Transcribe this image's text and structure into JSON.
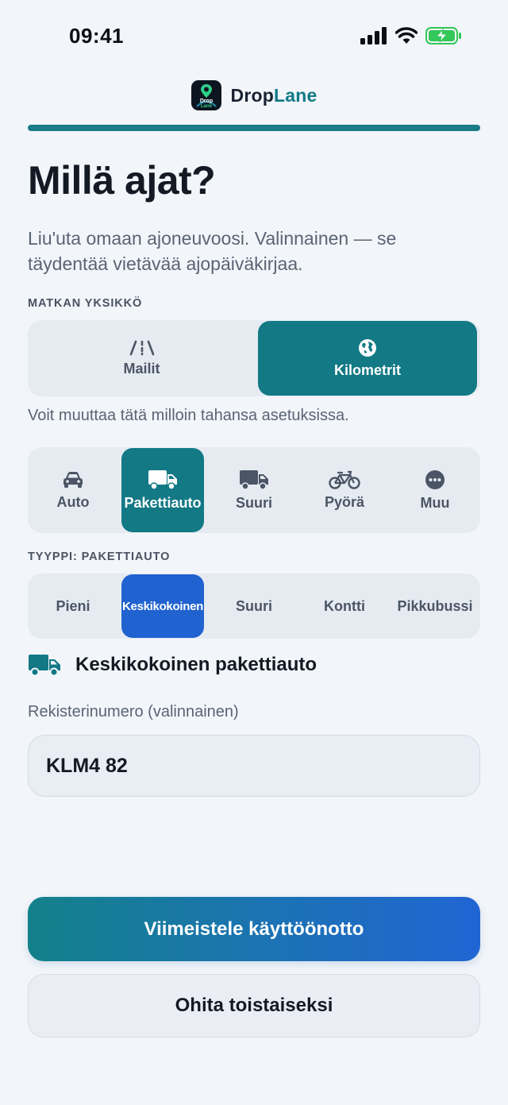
{
  "status_bar": {
    "time": "09:41",
    "icons": [
      "signal-icon",
      "wifi-icon",
      "battery-charging-icon"
    ]
  },
  "brand": {
    "logo_text_1": "Drop",
    "logo_text_2": "Lane",
    "name_part1": "Drop",
    "name_part2": "Lane",
    "accent_color": "#0f7a86"
  },
  "progress": {
    "value": 1.0,
    "color": "#1a7c87"
  },
  "title": "Millä ajat?",
  "subtitle": "Liu'uta omaan ajoneuvoosi. Valinnainen — se täydentää vietävää ajopäiväkirjaa.",
  "unit_section": {
    "label": "MATKAN YKSIKKÖ",
    "options": [
      {
        "label": "Mailit",
        "icon": "road-icon",
        "selected": false
      },
      {
        "label": "Kilometrit",
        "icon": "globe-icon",
        "selected": true
      }
    ],
    "hint": "Voit muuttaa tätä milloin tahansa asetuksissa."
  },
  "vehicle_categories": [
    {
      "label": "Auto",
      "icon": "car-icon",
      "selected": false
    },
    {
      "label": "Pakettiauto",
      "icon": "van-icon",
      "selected": true
    },
    {
      "label": "Suuri",
      "icon": "truck-icon",
      "selected": false
    },
    {
      "label": "Pyörä",
      "icon": "bicycle-icon",
      "selected": false
    },
    {
      "label": "Muu",
      "icon": "more-icon",
      "selected": false
    }
  ],
  "type_section": {
    "label": "TYYPPI: PAKETTIAUTO",
    "options": [
      {
        "label": "Pieni",
        "selected": false
      },
      {
        "label": "Keskikokoinen",
        "selected": true
      },
      {
        "label": "Suuri",
        "selected": false
      },
      {
        "label": "Kontti",
        "selected": false
      },
      {
        "label": "Pikkubussi",
        "selected": false
      }
    ]
  },
  "selected_vehicle": {
    "icon": "van-icon",
    "label": "Keskikokoinen pakettiauto"
  },
  "plate": {
    "label": "Rekisterinumero (valinnainen)",
    "value": "KLM4 82"
  },
  "buttons": {
    "primary": "Viimeistele käyttöönotto",
    "secondary": "Ohita toistaiseksi"
  },
  "colors": {
    "primary_teal": "#127985",
    "type_blue": "#2062cf",
    "background": "#f2f5fa"
  }
}
